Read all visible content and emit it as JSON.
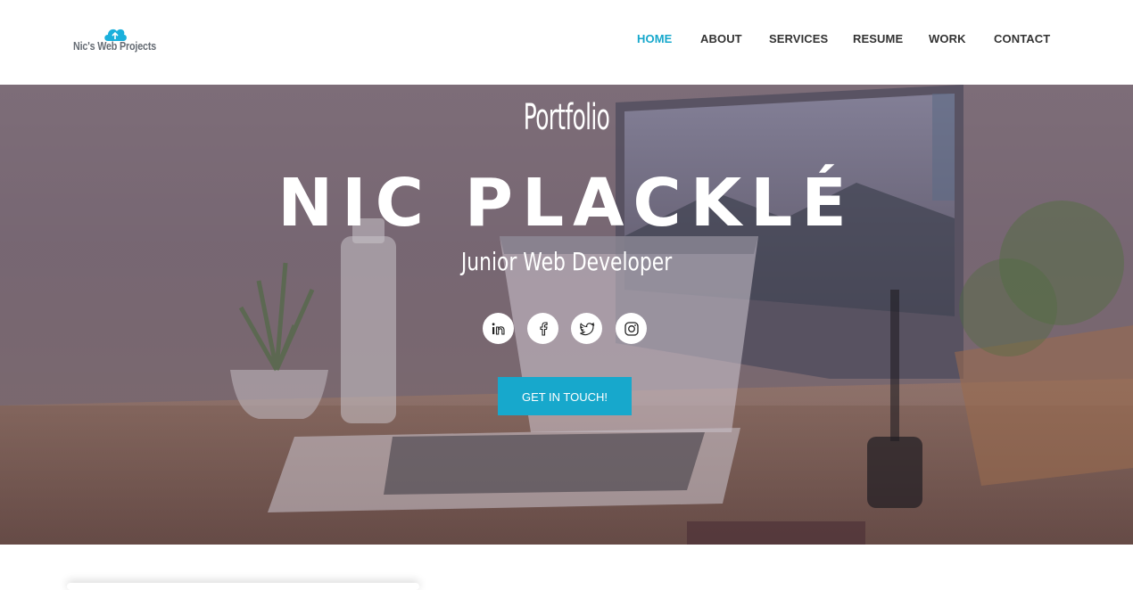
{
  "brand": {
    "logo_text": "Nic's Web Projects",
    "accent_color": "#17a8cc"
  },
  "nav": {
    "items": [
      {
        "label": "HOME",
        "active": true
      },
      {
        "label": "ABOUT",
        "active": false
      },
      {
        "label": "SERVICES",
        "active": false
      },
      {
        "label": "RESUME",
        "active": false
      },
      {
        "label": "WORK",
        "active": false
      },
      {
        "label": "CONTACT",
        "active": false
      }
    ]
  },
  "hero": {
    "kicker": "Portfolio",
    "name": "NIC PLACKLÉ",
    "role": "Junior Web Developer",
    "social": [
      {
        "icon": "linkedin-icon"
      },
      {
        "icon": "facebook-icon"
      },
      {
        "icon": "twitter-icon"
      },
      {
        "icon": "instagram-icon"
      }
    ],
    "cta_label": "GET IN TOUCH!"
  }
}
